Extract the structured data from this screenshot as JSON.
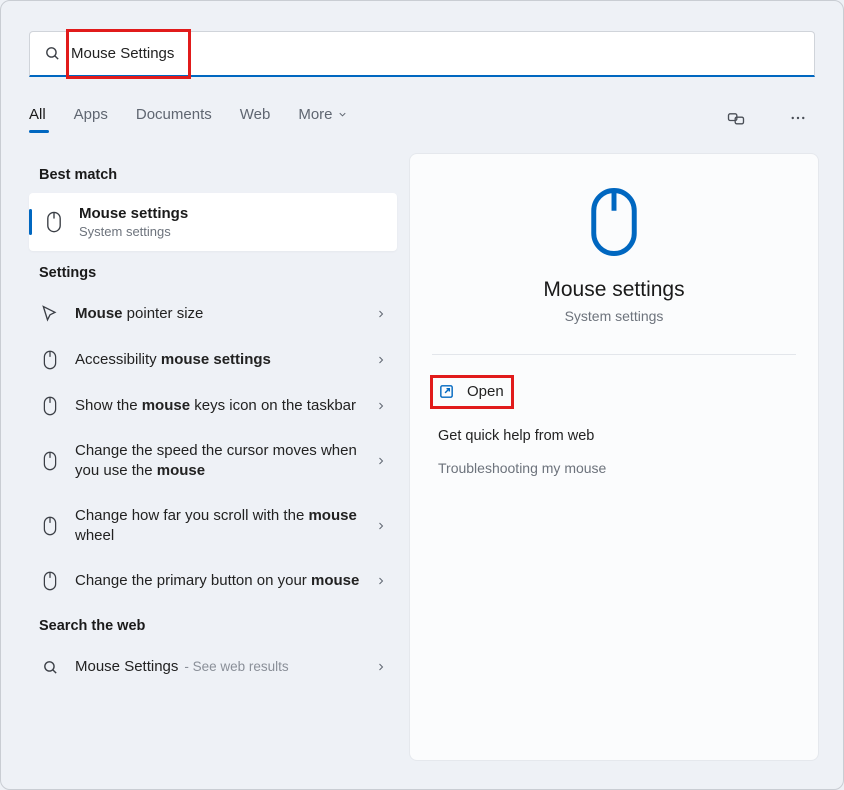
{
  "search": {
    "query": "Mouse Settings"
  },
  "tabs": {
    "all": "All",
    "apps": "Apps",
    "documents": "Documents",
    "web": "Web",
    "more": "More"
  },
  "sections": {
    "best_match": "Best match",
    "settings": "Settings",
    "search_web": "Search the web"
  },
  "best_match": {
    "title": "Mouse settings",
    "subtitle": "System settings"
  },
  "settings_results": [
    {
      "html": "<b>Mouse</b> pointer size"
    },
    {
      "html": "Accessibility <b>mouse settings</b>"
    },
    {
      "html": "Show the <b>mouse</b> keys icon on the taskbar"
    },
    {
      "html": "Change the speed the cursor moves when you use the <b>mouse</b>"
    },
    {
      "html": "Change how far you scroll with the <b>mouse</b> wheel"
    },
    {
      "html": "Change the primary button on your <b>mouse</b>"
    }
  ],
  "web_result": {
    "label": "Mouse Settings",
    "hint": "- See web results"
  },
  "detail": {
    "title": "Mouse settings",
    "subtitle": "System settings",
    "open": "Open",
    "help_header": "Get quick help from web",
    "help_links": [
      "Troubleshooting my mouse"
    ]
  }
}
